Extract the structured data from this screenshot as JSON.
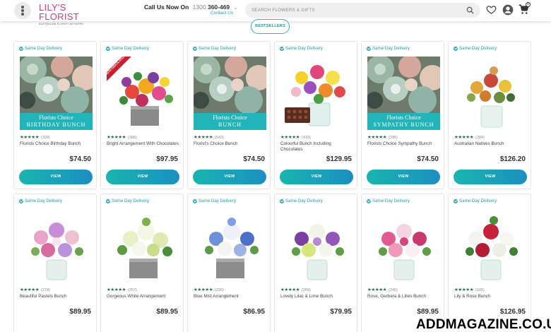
{
  "header": {
    "logo_main": "LILY'S FLORIST",
    "logo_sub": "AUSTRALIAN FLORIST NETWORK",
    "call_label": "Call Us Now On",
    "phone_prefix": "1300",
    "phone_rest": "360-469",
    "contact_label": "Contact Us",
    "search_placeholder": "SEARCH FLOWERS & GIFTS",
    "cart_count": "0"
  },
  "bestsellers_label": "BESTSELLERS",
  "badge_label": "Same Day Delivery",
  "view_label": "VIEW",
  "stars": "★★★★★",
  "products": [
    {
      "name": "Florists Choice Birthday Bunch",
      "reviews": "(328)",
      "price": "$74.50",
      "banner_l1": "Florists Choice",
      "banner_l2": "BIRTHDAY BUNCH"
    },
    {
      "name": "Bright Arrangement With Chocolates",
      "reviews": "(386)",
      "price": "$97.95",
      "ribbon": "WITH CHOCOLATES"
    },
    {
      "name": "Florist's Choice Bunch",
      "reviews": "(543)",
      "price": "$74.50",
      "banner_l1": "Florists Choice",
      "banner_l2": "BUNCH"
    },
    {
      "name": "Colourful Bunch Including Chocolates",
      "reviews": "(433)",
      "price": "$129.95"
    },
    {
      "name": "Florists Choice Sympathy Bunch",
      "reviews": "(295)",
      "price": "$74.50",
      "banner_l1": "Florists Choice",
      "banner_l2": "SYMPATHY BUNCH"
    },
    {
      "name": "Australian Natives Bunch",
      "reviews": "(284)",
      "price": "$126.20"
    },
    {
      "name": "Beautiful Pastels Bunch",
      "reviews": "(274)",
      "price": "$89.95"
    },
    {
      "name": "Gorgeous White Arrangement",
      "reviews": "(257)",
      "price": "$89.95"
    },
    {
      "name": "Blue Mist Arrangement",
      "reviews": "(230)",
      "price": "$86.95"
    },
    {
      "name": "Lovely Lilac & Lime Bunch",
      "reviews": "(209)",
      "price": "$79.95"
    },
    {
      "name": "Rose, Gerbera & Lilies Bunch",
      "reviews": "(240)",
      "price": "$89.95"
    },
    {
      "name": "Lily & Rose Bunch",
      "reviews": "(165)",
      "price": "$126.95"
    }
  ],
  "watermark": "ADDMAGAZINE.CO.UK",
  "colors": {
    "accent": "#1fb1b5",
    "brand": "#d23a7a",
    "banner": "#21b4b9"
  }
}
